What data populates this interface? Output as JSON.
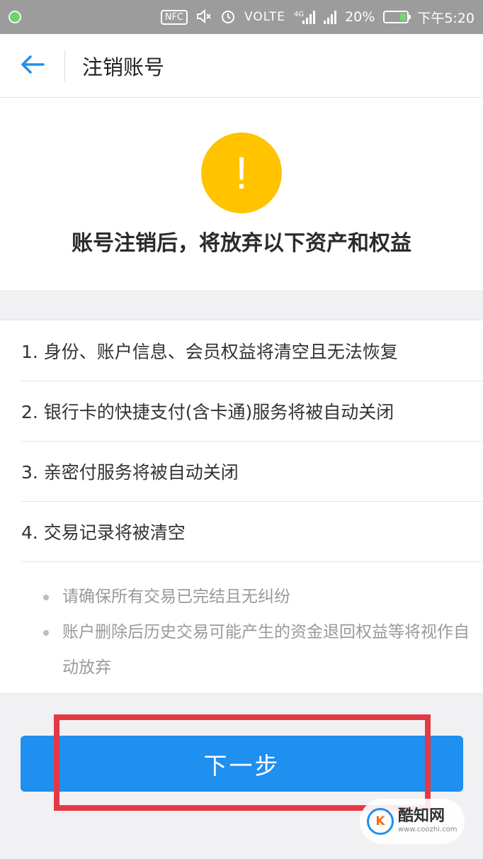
{
  "status_bar": {
    "nfc": "NFC",
    "network": "VOLTE",
    "network_type": "4G",
    "battery": "20%",
    "time": "下午5:20"
  },
  "header": {
    "title": "注销账号",
    "back_icon": "back-arrow-icon"
  },
  "warning": {
    "icon_symbol": "!",
    "title": "账号注销后，将放弃以下资产和权益"
  },
  "items": [
    "1. 身份、账户信息、会员权益将清空且无法恢复",
    "2. 银行卡的快捷支付(含卡通)服务将被自动关闭",
    "3. 亲密付服务将被自动关闭",
    "4. 交易记录将被清空"
  ],
  "notes": [
    "请确保所有交易已完结且无纠纷",
    "账户删除后历史交易可能产生的资金退回权益等将视作自动放弃"
  ],
  "next_button": {
    "label": "下一步"
  },
  "watermark": {
    "name": "酷知网",
    "url": "www.coozhi.com"
  },
  "colors": {
    "accent": "#1f8ff0",
    "warning": "#ffc300",
    "highlight": "#e23a45"
  }
}
